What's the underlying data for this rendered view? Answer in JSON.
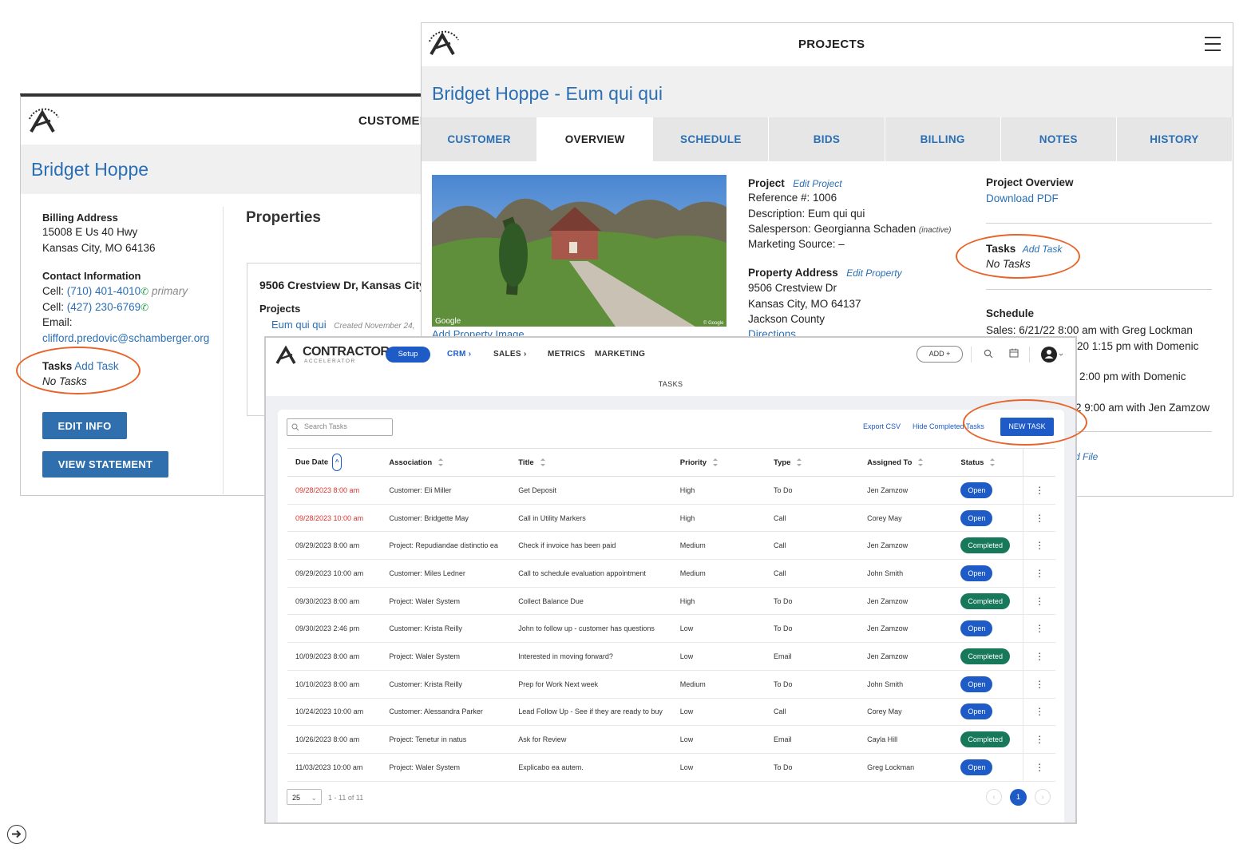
{
  "customer_window": {
    "header_title": "CUSTOMER",
    "name": "Bridget Hoppe",
    "billing_label": "Billing Address",
    "billing_line1": "15008 E Us 40 Hwy",
    "billing_line2": "Kansas City, MO 64136",
    "contact_label": "Contact Information",
    "cell_prefix": "Cell:",
    "cell1": "(710) 401-4010",
    "cell1_note": "primary",
    "cell2": "(427) 230-6769",
    "email_label": "Email:",
    "email": "clifford.predovic@schamberger.org",
    "tasks_label": "Tasks",
    "add_task": "Add Task",
    "no_tasks": "No Tasks",
    "edit_info": "EDIT INFO",
    "view_statement": "VIEW STATEMENT",
    "properties_title": "Properties",
    "property_address": "9506 Crestview Dr, Kansas City",
    "projects_label": "Projects",
    "project_link": "Eum qui qui",
    "project_created": "Created November 24,"
  },
  "project_window": {
    "header_title": "PROJECTS",
    "title": "Bridget Hoppe - Eum qui qui",
    "tabs": [
      "CUSTOMER",
      "OVERVIEW",
      "SCHEDULE",
      "BIDS",
      "BILLING",
      "NOTES",
      "HISTORY"
    ],
    "active_tab": "OVERVIEW",
    "project_label": "Project",
    "edit_project": "Edit Project",
    "reference": "Reference #: 1006",
    "description": "Description: Eum qui qui",
    "salesperson": "Salesperson: Georgianna Schaden",
    "inactive": "(inactive)",
    "marketing": "Marketing Source: –",
    "property_label": "Property Address",
    "edit_property": "Edit Property",
    "addr1": "9506 Crestview Dr",
    "addr2": "Kansas City, MO 64137",
    "county": "Jackson County",
    "directions": "Directions",
    "add_image": "Add Property Image",
    "photo_watermark": "Google",
    "photo_copyright": "© Google",
    "overview_label": "Project Overview",
    "download_pdf": "Download PDF",
    "tasks_label": "Tasks",
    "add_task": "Add Task",
    "no_tasks": "No Tasks",
    "schedule_label": "Schedule",
    "schedule_1": "Sales: 6/21/22 8:00 am with Greg Lockman",
    "schedule_2": "20 1:15 pm with Domenic",
    "schedule_3": "2:00 pm with Domenic",
    "schedule_4": "2 9:00 am with Jen Zamzow",
    "file_link": "d File"
  },
  "tasks_window": {
    "brand_main": "CONTRACTOR",
    "brand_sub": "ACCELERATOR",
    "nav": {
      "setup": "Setup",
      "crm": "CRM",
      "sales": "SALES",
      "metrics": "METRICS",
      "marketing": "MARKETING",
      "add": "ADD"
    },
    "page_title": "TASKS",
    "search_placeholder": "Search Tasks",
    "export_csv": "Export CSV",
    "hide_completed": "Hide Completed Tasks",
    "new_task": "NEW TASK",
    "columns": [
      "Due Date",
      "Association",
      "Title",
      "Priority",
      "Type",
      "Assigned To",
      "Status"
    ],
    "rows": [
      {
        "due": "09/28/2023 8:00 am",
        "overdue": true,
        "association": "Customer: Eli Miller",
        "title": "Get Deposit",
        "priority": "High",
        "type": "To Do",
        "assigned": "Jen Zamzow",
        "status": "Open"
      },
      {
        "due": "09/28/2023 10:00 am",
        "overdue": true,
        "association": "Customer: Bridgette May",
        "title": "Call in Utility Markers",
        "priority": "High",
        "type": "Call",
        "assigned": "Corey May",
        "status": "Open"
      },
      {
        "due": "09/29/2023 8:00 am",
        "overdue": false,
        "association": "Project: Repudiandae distinctio ea",
        "title": "Check if invoice has been paid",
        "priority": "Medium",
        "type": "Call",
        "assigned": "Jen Zamzow",
        "status": "Completed"
      },
      {
        "due": "09/29/2023 10:00 am",
        "overdue": false,
        "association": "Customer: Miles Ledner",
        "title": "Call to schedule evaluation appointment",
        "priority": "Medium",
        "type": "Call",
        "assigned": "John Smith",
        "status": "Open"
      },
      {
        "due": "09/30/2023 8:00 am",
        "overdue": false,
        "association": "Project: Waler System",
        "title": "Collect Balance Due",
        "priority": "High",
        "type": "To Do",
        "assigned": "Jen Zamzow",
        "status": "Completed"
      },
      {
        "due": "09/30/2023 2:46 pm",
        "overdue": false,
        "association": "Customer: Krista Reilly",
        "title": "John to follow up - customer has questions",
        "priority": "Low",
        "type": "To Do",
        "assigned": "Jen Zamzow",
        "status": "Open"
      },
      {
        "due": "10/09/2023 8:00 am",
        "overdue": false,
        "association": "Project: Waler System",
        "title": "Interested in moving forward?",
        "priority": "Low",
        "type": "Email",
        "assigned": "Jen Zamzow",
        "status": "Completed"
      },
      {
        "due": "10/10/2023 8:00 am",
        "overdue": false,
        "association": "Customer: Krista Reilly",
        "title": "Prep for Work Next week",
        "priority": "Medium",
        "type": "To Do",
        "assigned": "John Smith",
        "status": "Open"
      },
      {
        "due": "10/24/2023 10:00 am",
        "overdue": false,
        "association": "Customer: Alessandra Parker",
        "title": "Lead Follow Up - See if they are ready to buy",
        "priority": "Low",
        "type": "Call",
        "assigned": "Corey May",
        "status": "Open"
      },
      {
        "due": "10/26/2023 8:00 am",
        "overdue": false,
        "association": "Project: Tenetur in natus",
        "title": "Ask for Review",
        "priority": "Low",
        "type": "Email",
        "assigned": "Cayla Hill",
        "status": "Completed"
      },
      {
        "due": "11/03/2023 10:00 am",
        "overdue": false,
        "association": "Project: Waler System",
        "title": "Explicabo ea autem.",
        "priority": "Low",
        "type": "To Do",
        "assigned": "Greg Lockman",
        "status": "Open"
      }
    ],
    "page_size": "25",
    "range": "1 - 11 of 11",
    "current_page": "1"
  },
  "colors": {
    "accent": "#2a6fb5",
    "highlight": "#e8642b",
    "open": "#1e5bc6",
    "completed": "#17785a",
    "overdue": "#d9322f"
  },
  "icons": [
    "logo-icon",
    "menu-icon",
    "phone-icon",
    "search-icon",
    "calendar-icon",
    "user-icon",
    "plus-icon",
    "chevron-right-icon",
    "chevron-down-icon",
    "arrow-right-icon"
  ]
}
